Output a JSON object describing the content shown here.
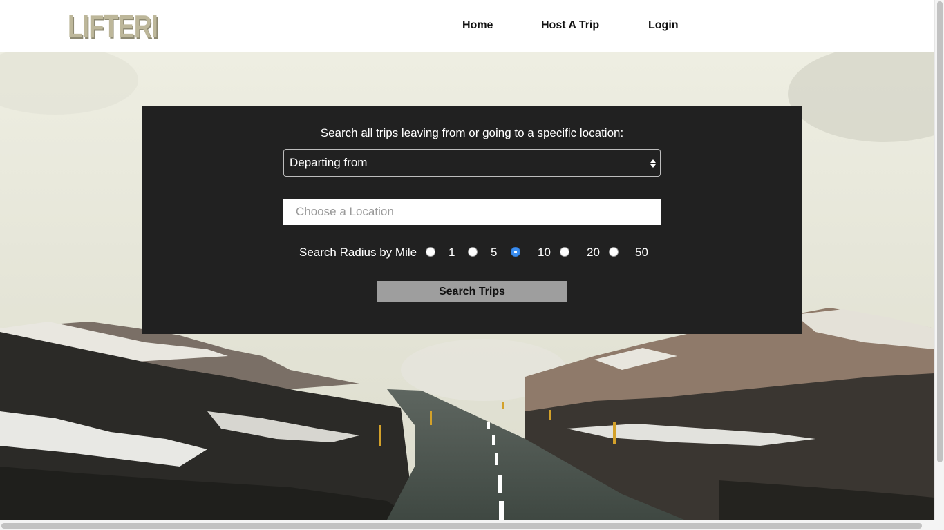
{
  "header": {
    "logo_text": "LIFTERI",
    "nav": {
      "home": "Home",
      "host_trip": "Host A Trip",
      "login": "Login"
    }
  },
  "search": {
    "prompt": "Search all trips leaving from or going to a specific location:",
    "direction_select": {
      "selected": "Departing from"
    },
    "location_input": {
      "placeholder": "Choose a Location",
      "value": ""
    },
    "radius": {
      "label": "Search Radius by Mile",
      "options": [
        "1",
        "5",
        "10",
        "20",
        "50"
      ],
      "selected": "10"
    },
    "submit_label": "Search Trips"
  },
  "colors": {
    "panel_bg": "#212121",
    "logo": "#bdb79a",
    "radio_selected": "#3b8ef0",
    "button_bg": "#9e9e9e"
  }
}
